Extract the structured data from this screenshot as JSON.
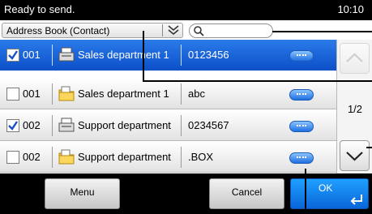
{
  "status": {
    "text": "Ready to send.",
    "time": "10:10"
  },
  "address_book": {
    "label": "Address Book (Contact)"
  },
  "search": {
    "placeholder": ""
  },
  "rows": [
    {
      "number": "001",
      "name": "Sales department 1",
      "value": "0123456",
      "checked": true,
      "selected": true,
      "icon": "fax-icon"
    },
    {
      "number": "001",
      "name": "Sales department 1",
      "value": "abc",
      "checked": false,
      "selected": false,
      "icon": "folder-icon"
    },
    {
      "number": "002",
      "name": "Support department",
      "value": "0234567",
      "checked": true,
      "selected": false,
      "icon": "fax-icon"
    },
    {
      "number": "002",
      "name": "Support department",
      "value": ".BOX",
      "checked": false,
      "selected": false,
      "icon": "folder-icon"
    }
  ],
  "pagination": {
    "indicator": "1/2"
  },
  "buttons": {
    "menu": "Menu",
    "cancel": "Cancel",
    "ok": "OK"
  },
  "colors": {
    "accent": "#0c4fc8",
    "ok": "#1389f0"
  }
}
